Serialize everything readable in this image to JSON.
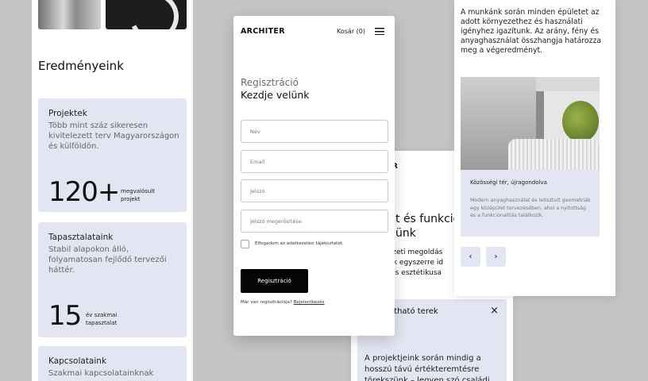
{
  "left": {
    "section_title": "Eredményeink",
    "cards": [
      {
        "title": "Projektek",
        "desc": "Több mint száz sikeresen kivitelezett terv Magyarországon és külföldön.",
        "stat_value": "120+",
        "stat_label": "megvalósult projekt"
      },
      {
        "title": "Tapasztalataink",
        "desc": "Stabil alapokon álló, folyamatosan fejlődő tervezői háttér.",
        "stat_value": "15",
        "stat_label": "év szakmai tapasztalat"
      },
      {
        "title": "Kapcsolataink",
        "desc": "Szakmai kapcsolatainknak"
      }
    ]
  },
  "mid_back": {
    "brand_fragment": "R",
    "heading": "t és funkcio\nünk",
    "text": "észeti megoldás\nyek egyszerre id\nk és esztétikusa",
    "popup": {
      "title": "tartható terek",
      "close": "×",
      "text": "A projektjeink során mindig a hosszú távú értékteremtésre törekszünk – legyen szó családi"
    }
  },
  "right": {
    "intro": "A munkánk során minden épületet az adott környezethez és használati igényhez igazítunk. Az arány, fény és anyaghasználat összhangja határozza meg a végeredményt.",
    "caption_title": "Közösségi tér, újragondolva",
    "caption_text": "Modern anyaghasználat és letisztult geometriák egy középület tervezésében, ahol a nyitottság és a funkcionalitás találkozik.",
    "prev": "‹",
    "next": "›"
  },
  "form": {
    "brand": "ARCHITER",
    "cart": "Kosár (0)",
    "subtitle": "Regisztráció",
    "title": "Kezdje velünk",
    "fields": {
      "name": "Név",
      "email": "Email",
      "password": "Jelszó",
      "password_confirm": "Jelszó megerősítése"
    },
    "consent": "Elfogadom az adatkezelési tájékoztatót.",
    "submit": "Regisztráció",
    "login_prompt": "Már van regisztrációja?",
    "login_link": "Bejelentkezés"
  }
}
